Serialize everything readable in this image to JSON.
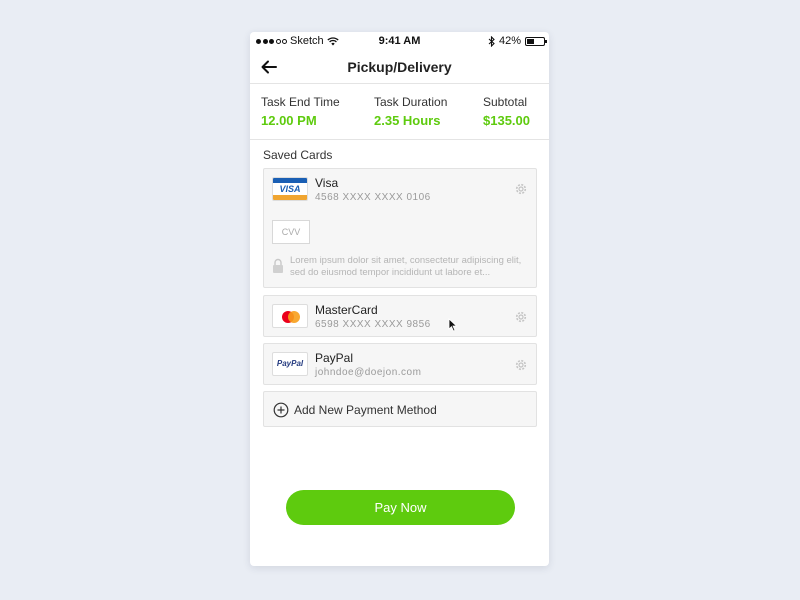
{
  "status_bar": {
    "carrier": "Sketch",
    "time": "9:41 AM",
    "battery": "42%"
  },
  "nav": {
    "title": "Pickup/Delivery",
    "back_icon": "arrow-left-icon"
  },
  "summary": [
    {
      "label": "Task End Time",
      "value": "12.00 PM"
    },
    {
      "label": "Task Duration",
      "value": "2.35 Hours"
    },
    {
      "label": "Subtotal",
      "value": "$135.00"
    }
  ],
  "saved_cards_title": "Saved Cards",
  "cards": [
    {
      "name": "Visa",
      "number": "4568 XXXX XXXX 0106",
      "logo_text": "VISA",
      "cvv_placeholder": "CVV",
      "note": "Lorem ipsum dolor sit amet, consectetur adipiscing elit, sed do eiusmod tempor incididunt ut labore et..."
    },
    {
      "name": "MasterCard",
      "number": "6598 XXXX XXXX 9856"
    },
    {
      "name": "PayPal",
      "number": "johndoe@doejon.com",
      "logo_text": "PayPal"
    }
  ],
  "add_method_label": "Add New Payment Method",
  "pay_button_label": "Pay Now",
  "colors": {
    "accent": "#5ecb0e",
    "visa_blue": "#1a5fb4",
    "visa_gold": "#f0a530",
    "mc_red": "#eb001b",
    "mc_orange": "#f79e1b",
    "paypal_navy": "#253b80"
  }
}
